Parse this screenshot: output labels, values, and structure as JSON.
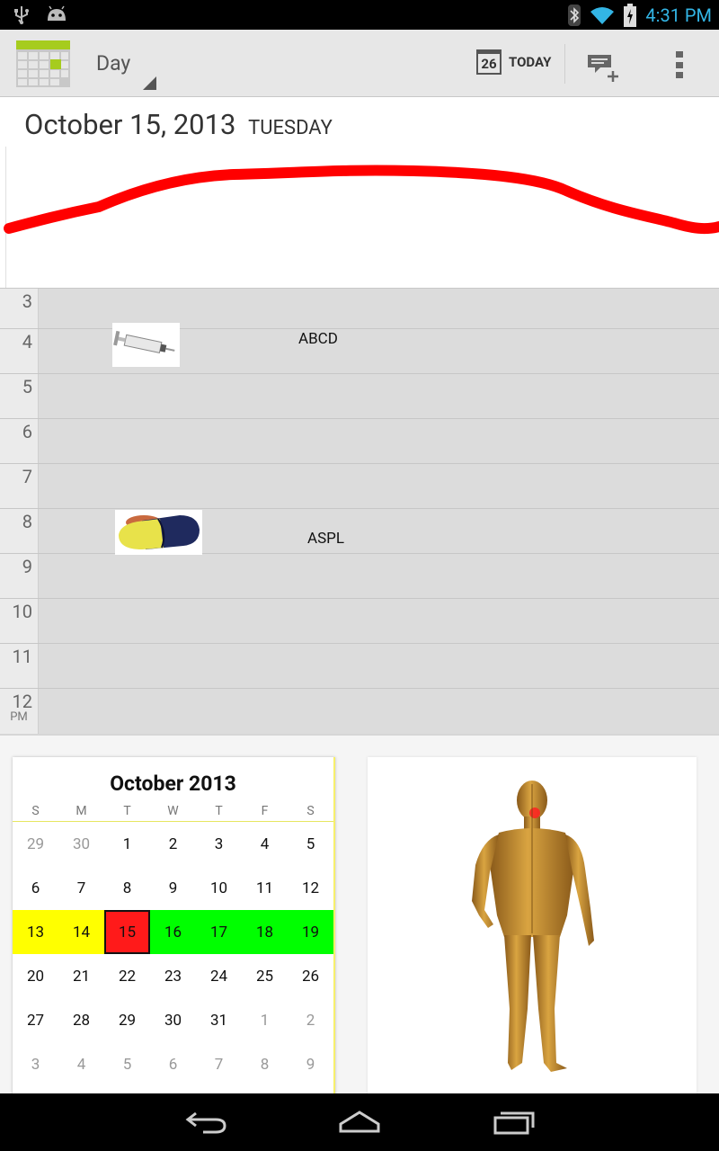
{
  "status_bar": {
    "time": "4:31 PM",
    "icons": [
      "usb-icon",
      "android-debug-icon",
      "bluetooth-icon",
      "wifi-icon",
      "battery-charging-icon"
    ]
  },
  "action_bar": {
    "view_mode": "Day",
    "today_badge": "26",
    "today_label": "TODAY",
    "icons": [
      "calendar-app-icon",
      "new-event-icon",
      "overflow-menu-icon"
    ]
  },
  "day_header": {
    "date": "October 15, 2013",
    "weekday": "TUESDAY"
  },
  "hours": [
    {
      "label": "3",
      "suffix": ""
    },
    {
      "label": "4",
      "suffix": ""
    },
    {
      "label": "5",
      "suffix": ""
    },
    {
      "label": "6",
      "suffix": ""
    },
    {
      "label": "7",
      "suffix": ""
    },
    {
      "label": "8",
      "suffix": ""
    },
    {
      "label": "9",
      "suffix": ""
    },
    {
      "label": "10",
      "suffix": ""
    },
    {
      "label": "11",
      "suffix": ""
    },
    {
      "label": "12",
      "suffix": "PM"
    }
  ],
  "events": [
    {
      "title": "ABCD",
      "image": "syringe-image"
    },
    {
      "title": "ASPL",
      "image": "capsule-image"
    }
  ],
  "mini_calendar": {
    "title": "October 2013",
    "weekdays": [
      "S",
      "M",
      "T",
      "W",
      "T",
      "F",
      "S"
    ],
    "weeks": [
      [
        "29",
        "30",
        "1",
        "2",
        "3",
        "4",
        "5"
      ],
      [
        "6",
        "7",
        "8",
        "9",
        "10",
        "11",
        "12"
      ],
      [
        "13",
        "14",
        "15",
        "16",
        "17",
        "18",
        "19"
      ],
      [
        "20",
        "21",
        "22",
        "23",
        "24",
        "25",
        "26"
      ],
      [
        "27",
        "28",
        "29",
        "30",
        "31",
        "1",
        "2"
      ],
      [
        "3",
        "4",
        "5",
        "6",
        "7",
        "8",
        "9"
      ]
    ]
  },
  "colors": {
    "accent": "#33b5e5",
    "wave": "#ff0000",
    "highlight_yellow": "#ffff00",
    "highlight_green": "#00ff00",
    "selected_red": "#ff1a1a"
  },
  "nav_bar": {
    "icons": [
      "back-icon",
      "home-icon",
      "recents-icon"
    ]
  }
}
